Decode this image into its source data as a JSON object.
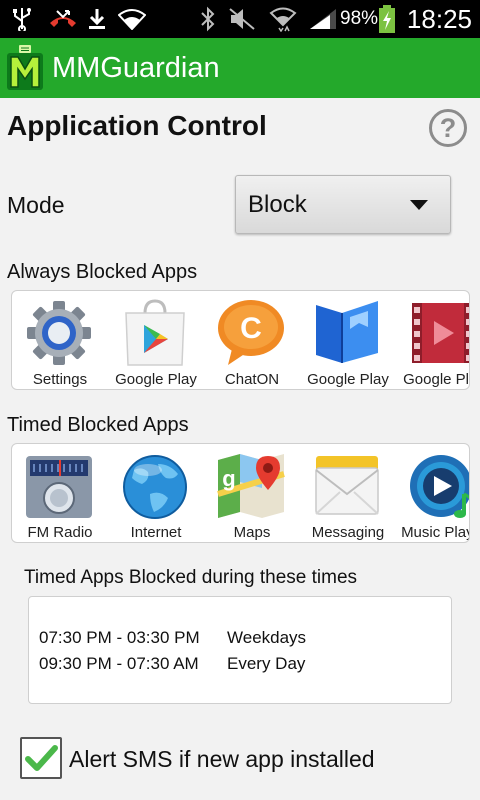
{
  "status_bar": {
    "battery_percent": "98%",
    "time": "18:25",
    "icons": [
      "usb-icon",
      "missed-call-icon",
      "download-icon",
      "wifi-icon",
      "bluetooth-icon",
      "mute-icon",
      "wifi-data-icon",
      "signal-icon",
      "battery-charging-icon"
    ]
  },
  "action_bar": {
    "app_name": "MMGuardian",
    "logo_icon": "mmguardian-logo-icon",
    "color": "#24a92b"
  },
  "page": {
    "title": "Application Control",
    "help_symbol": "?"
  },
  "mode": {
    "label": "Mode",
    "selected": "Block"
  },
  "always_blocked": {
    "label": "Always Blocked Apps",
    "apps": [
      {
        "name": "Settings",
        "icon": "settings-icon"
      },
      {
        "name": "Google Play",
        "icon": "play-store-icon"
      },
      {
        "name": "ChatON",
        "icon": "chaton-icon"
      },
      {
        "name": "Google Play",
        "icon": "play-books-icon"
      },
      {
        "name": "Google Play",
        "icon": "play-movies-icon"
      }
    ]
  },
  "timed_blocked": {
    "label": "Timed Blocked Apps",
    "apps": [
      {
        "name": "FM Radio",
        "icon": "fm-radio-icon"
      },
      {
        "name": "Internet",
        "icon": "globe-icon"
      },
      {
        "name": "Maps",
        "icon": "maps-icon"
      },
      {
        "name": "Messaging",
        "icon": "messaging-icon"
      },
      {
        "name": "Music Player",
        "icon": "music-player-icon"
      }
    ]
  },
  "schedule": {
    "label": "Timed Apps Blocked during these times",
    "rows": [
      {
        "range": "07:30 PM - 03:30 PM",
        "days": "Weekdays"
      },
      {
        "range": "09:30 PM - 07:30 AM",
        "days": "Every Day"
      }
    ]
  },
  "alert": {
    "label": "Alert SMS if new app installed",
    "checked": true
  }
}
